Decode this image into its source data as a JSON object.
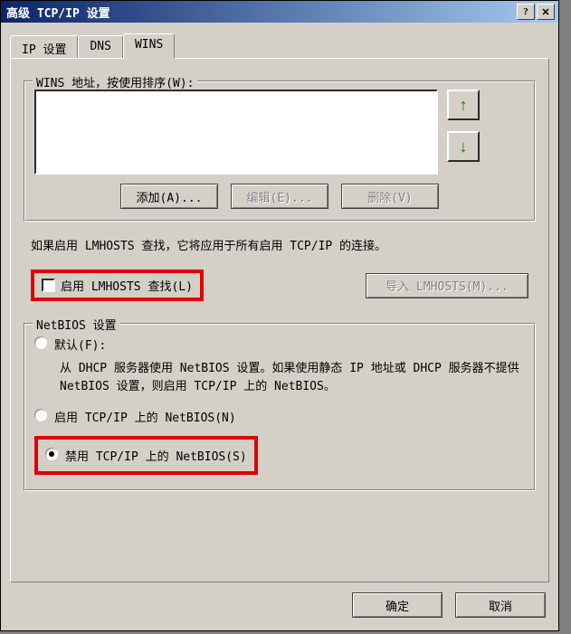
{
  "window": {
    "title": "高级 TCP/IP 设置"
  },
  "tabs": {
    "ip": "IP 设置",
    "dns": "DNS",
    "wins": "WINS"
  },
  "wins_group": {
    "legend": "WINS 地址，按使用排序(W):",
    "add_btn": "添加(A)...",
    "edit_btn": "编辑(E)...",
    "delete_btn": "删除(V)"
  },
  "lmhosts": {
    "info": "如果启用 LMHOSTS 查找，它将应用于所有启用 TCP/IP 的连接。",
    "enable_label": "启用 LMHOSTS 查找(L)",
    "import_btn": "导入 LMHOSTS(M)..."
  },
  "netbios": {
    "legend": "NetBIOS 设置",
    "default_label": "默认(F):",
    "default_desc": "从 DHCP 服务器使用 NetBIOS 设置。如果使用静态 IP 地址或 DHCP 服务器不提供 NetBIOS 设置，则启用 TCP/IP 上的 NetBIOS。",
    "enable_label": "启用 TCP/IP 上的 NetBIOS(N)",
    "disable_label": "禁用 TCP/IP 上的 NetBIOS(S)"
  },
  "footer": {
    "ok": "确定",
    "cancel": "取消"
  }
}
